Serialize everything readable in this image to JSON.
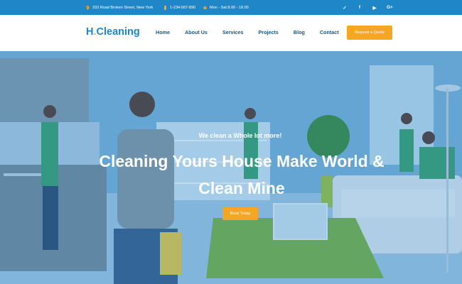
{
  "topbar": {
    "address": "333 Road Broken Street, New York",
    "phone": "1-234-567-890",
    "hours": "Mon - Sat 8.00 - 18.00",
    "social": [
      "twitter-icon",
      "facebook-icon",
      "youtube-icon",
      "google-plus-icon"
    ],
    "social_glyphs": [
      "✓",
      "f",
      "▶",
      "G+"
    ],
    "color": "#1f86c8"
  },
  "header": {
    "logo_main": "H",
    "logo_dot": ".",
    "logo_rest": "Cleaning",
    "nav": [
      "Home",
      "About Us",
      "Services",
      "Projects",
      "Blog",
      "Contact"
    ],
    "quote_label": "Request a Quote",
    "accent": "#f5a623"
  },
  "hero": {
    "tagline": "We clean a Whole lot more!",
    "headline": "Cleaning Yours House Make World & Clean Mine",
    "button_label": "Book Today"
  }
}
